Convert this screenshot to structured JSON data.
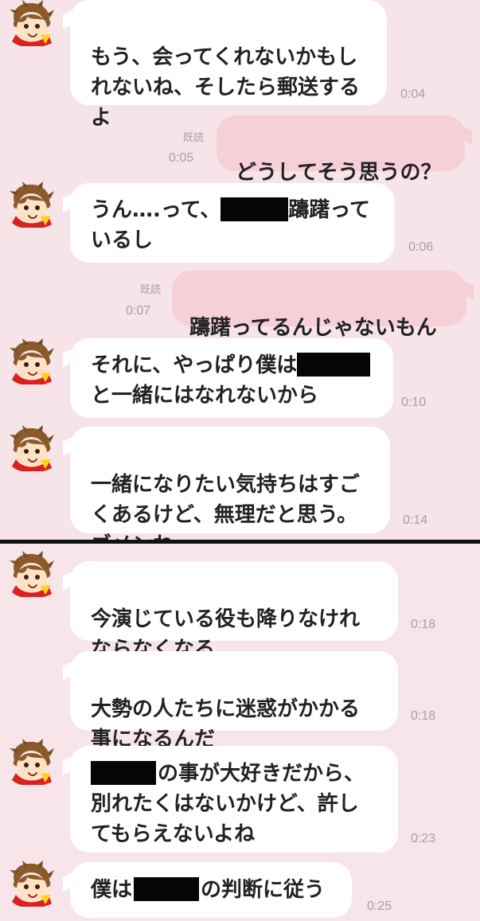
{
  "chat": {
    "top": {
      "m1": {
        "text": "もう、会ってくれないかもし\nれないね、そしたら郵送する\nよ",
        "time": "0:04"
      },
      "m2": {
        "read": "既読",
        "readTime": "0:05",
        "text": "どうしてそう思うの？"
      },
      "m3": {
        "a": "うん….って、",
        "b": "躊躇って",
        "c": "いるし",
        "time": "0:06"
      },
      "m4": {
        "read": "既読",
        "readTime": "0:07",
        "text": "躊躇ってるんじゃないもん"
      },
      "m5": {
        "a": "それに、やっぱり僕は",
        "b": "と一緒にはなれないから",
        "time": "0:10"
      },
      "m6": {
        "text": "一緒になりたい気持ちはすご\nくあるけど、無理だと思う。\nゴメンね",
        "time": "0:14"
      }
    },
    "bottom": {
      "m7": {
        "text": "今演じている役も降りなけれ\nならなくなる",
        "time": "0:18"
      },
      "m8": {
        "text": "大勢の人たちに迷惑がかかる\n事になるんだ",
        "time": "0:18"
      },
      "m9": {
        "a": "の事が大好きだから、",
        "b": "別れたくはないかけど、許し",
        "c": "てもらえないよね",
        "time": "0:23"
      },
      "m10": {
        "a": "僕は",
        "b": "の判断に従う",
        "time": "0:25"
      }
    }
  },
  "icons": {
    "avatar": "cartoon-avatar-icon"
  },
  "colors": {
    "background": "#f6e4e8",
    "incomingBubble": "#ffffff",
    "outgoingBubble": "#f7cfd9",
    "meta": "#a9a0a2",
    "redaction": "#050505"
  }
}
